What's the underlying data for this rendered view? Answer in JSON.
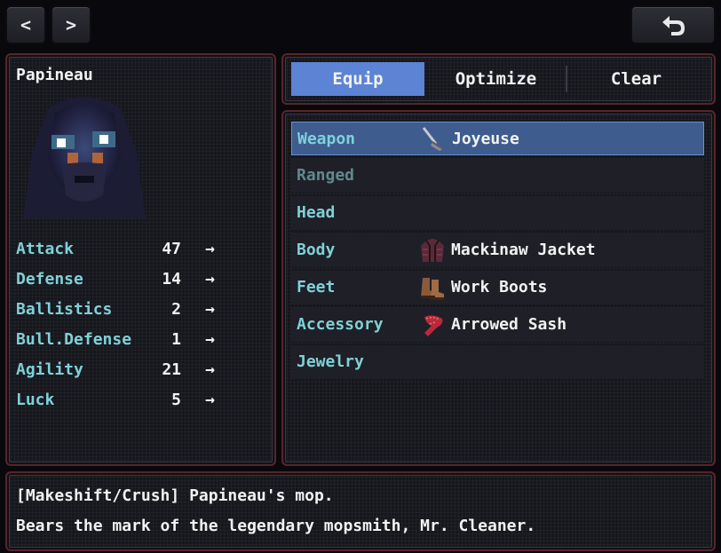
{
  "nav": {
    "prev_label": "<",
    "next_label": ">",
    "back_label": "↶"
  },
  "character": {
    "name": "Papineau"
  },
  "stats": [
    {
      "label": "Attack",
      "value": "47",
      "arrow": "→"
    },
    {
      "label": "Defense",
      "value": "14",
      "arrow": "→"
    },
    {
      "label": "Ballistics",
      "value": "2",
      "arrow": "→"
    },
    {
      "label": "Bull.Defense",
      "value": "1",
      "arrow": "→"
    },
    {
      "label": "Agility",
      "value": "21",
      "arrow": "→"
    },
    {
      "label": "Luck",
      "value": "5",
      "arrow": "→"
    }
  ],
  "tabs": [
    {
      "label": "Equip",
      "active": true
    },
    {
      "label": "Optimize",
      "active": false
    },
    {
      "label": "Clear",
      "active": false
    }
  ],
  "slots": [
    {
      "label": "Weapon",
      "item": "Joyeuse",
      "icon": "mop-icon",
      "selected": true
    },
    {
      "label": "Ranged",
      "item": "",
      "icon": "",
      "disabled": true
    },
    {
      "label": "Head",
      "item": "",
      "icon": ""
    },
    {
      "label": "Body",
      "item": "Mackinaw Jacket",
      "icon": "jacket-icon"
    },
    {
      "label": "Feet",
      "item": "Work Boots",
      "icon": "boots-icon"
    },
    {
      "label": "Accessory",
      "item": "Arrowed Sash",
      "icon": "sash-icon"
    },
    {
      "label": "Jewelry",
      "item": "",
      "icon": ""
    }
  ],
  "description": {
    "line1": "[Makeshift/Crush] Papineau's mop.",
    "line2": "Bears the mark of the legendary mopsmith, Mr. Cleaner."
  },
  "colors": {
    "accent_blue": "#5d83d4",
    "selected_row": "#3e5c8e",
    "stat_cyan": "#7fd1d8",
    "panel_border": "#5a2428"
  }
}
